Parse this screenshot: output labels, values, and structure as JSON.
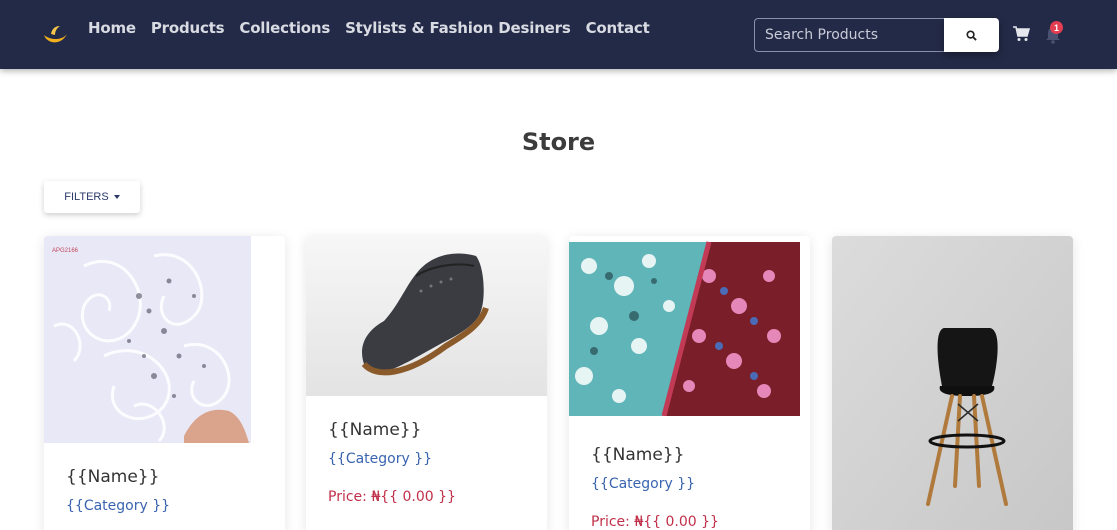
{
  "nav": {
    "links": [
      "Home",
      "Products",
      "Collections",
      "Stylists & Fashion Desiners",
      "Contact"
    ],
    "search_placeholder": "Search Products",
    "notification_count": "1"
  },
  "page": {
    "title": "Store",
    "filters_label": "FILTERS"
  },
  "products": [
    {
      "name": "{{Name}}",
      "category": "{{Category }}",
      "image": "white-lace-fabric"
    },
    {
      "name": "{{Name}}",
      "category": "{{Category }}",
      "price_label": "Price: ",
      "currency": "₦",
      "price": "{{ 0.00 }}",
      "image": "black-shoe"
    },
    {
      "name": "{{Name}}",
      "category": "{{Category }}",
      "price_label": "Price: ",
      "currency": "₦",
      "price": "{{ 0.00 }}",
      "image": "printed-fabric"
    },
    {
      "image": "black-chair"
    }
  ],
  "colors": {
    "navbar": "#232a47",
    "category": "#3a64b0",
    "price": "#c1304a",
    "badge": "#e23d51"
  }
}
